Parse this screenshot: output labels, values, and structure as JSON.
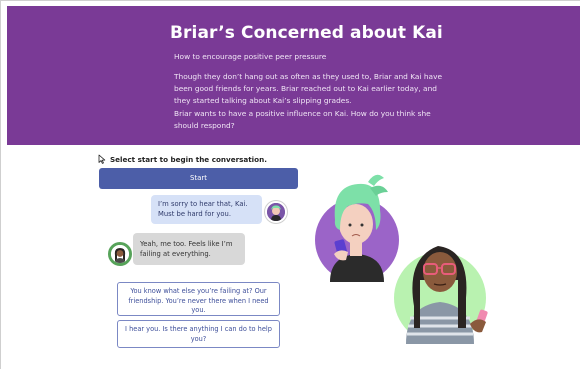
{
  "header": {
    "title": "Briar’s Concerned about Kai",
    "subtitle": "How to encourage positive peer pressure",
    "body_lines": [
      "Though they don’t hang out as often as they used to, Briar and Kai have been good friends for years. Briar reached out to Kai earlier today, and they started talking about Kai’s slipping grades.",
      "Briar wants to have a positive influence on Kai. How do you think she should respond?"
    ]
  },
  "conversation": {
    "instruction": "Select start to begin the conversation.",
    "start_label": "Start",
    "messages": [
      {
        "speaker": "Briar",
        "side": "right",
        "text": "I’m sorry to hear that, Kai. Must be hard for you."
      },
      {
        "speaker": "Kai",
        "side": "left",
        "text": "Yeah, me too. Feels like I’m failing at everything."
      }
    ],
    "choices": [
      "You know what else you’re failing at? Our friendship. You’re never there when I need you.",
      "I hear you. Is there anything I can do to help you?"
    ]
  },
  "colors": {
    "header_bg": "#7a3a96",
    "start_button": "#4c5ea8",
    "bubble_right": "#d6e1f7",
    "bubble_left": "#d8d8d8",
    "choice_border": "#7b88c4",
    "briar_circle": "#9b64c8",
    "kai_circle": "#b9f2b0"
  },
  "icons": [
    "cursor-pointer-icon",
    "briar-avatar-icon",
    "kai-avatar-icon"
  ]
}
